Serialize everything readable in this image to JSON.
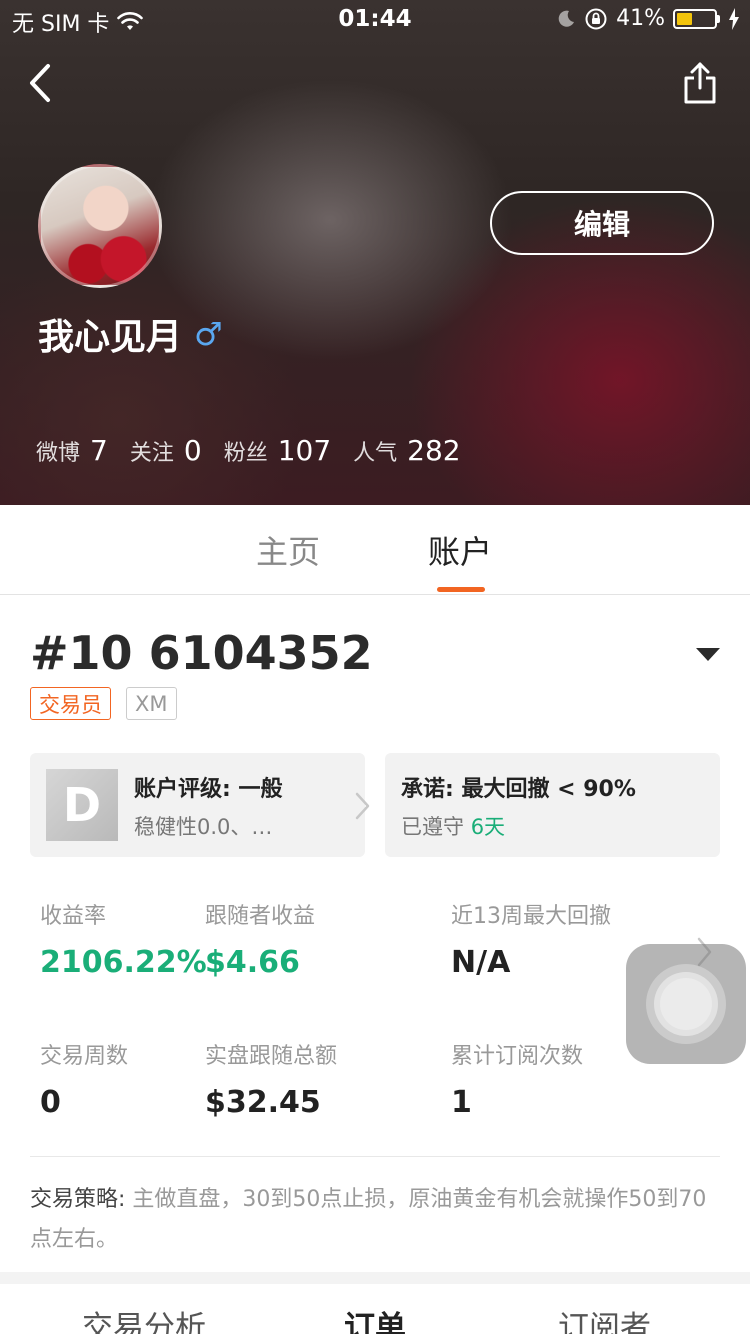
{
  "status_bar": {
    "carrier": "无 SIM 卡",
    "time": "01:44",
    "battery_percent": "41%",
    "battery_level": 0.41,
    "battery_color": "#f3c40c"
  },
  "header": {
    "back_icon": "chevron-left-icon",
    "share_icon": "share-icon",
    "edit_label": "编辑",
    "username": "我心见月",
    "gender_symbol": "♂",
    "stats": [
      {
        "label": "微博",
        "value": "7"
      },
      {
        "label": "关注",
        "value": "0"
      },
      {
        "label": "粉丝",
        "value": "107"
      },
      {
        "label": "人气",
        "value": "282"
      }
    ]
  },
  "tabs": {
    "home": "主页",
    "account": "账户",
    "active": "account",
    "accent_color": "#f26522"
  },
  "account": {
    "number": "#10 6104352",
    "tag_role": "交易员",
    "tag_broker": "XM",
    "rating_card": {
      "grade": "D",
      "title": "账户评级: 一般",
      "subtitle": "稳健性0.0、…"
    },
    "promise_card": {
      "title": "承诺: 最大回撤 < 90%",
      "kept_label": "已遵守",
      "kept_days": "6天"
    },
    "metrics": [
      {
        "label": "收益率",
        "value": "2106.22%",
        "highlight": true
      },
      {
        "label": "跟随者收益",
        "value": "$4.66",
        "highlight": true
      },
      {
        "label": "近13周最大回撤",
        "value": "N/A",
        "highlight": false
      },
      {
        "label": "交易周数",
        "value": "0",
        "highlight": false
      },
      {
        "label": "实盘跟随总额",
        "value": "$32.45",
        "highlight": false
      },
      {
        "label": "累计订阅次数",
        "value": "1",
        "highlight": false
      }
    ],
    "positive_color": "#1aae78",
    "strategy_label": "交易策略:",
    "strategy_text": "主做直盘，30到50点止损，原油黄金有机会就操作50到70点左右。"
  },
  "bottom_tabs": {
    "analysis": "交易分析",
    "orders": "订单",
    "subscribers": "订阅者"
  }
}
